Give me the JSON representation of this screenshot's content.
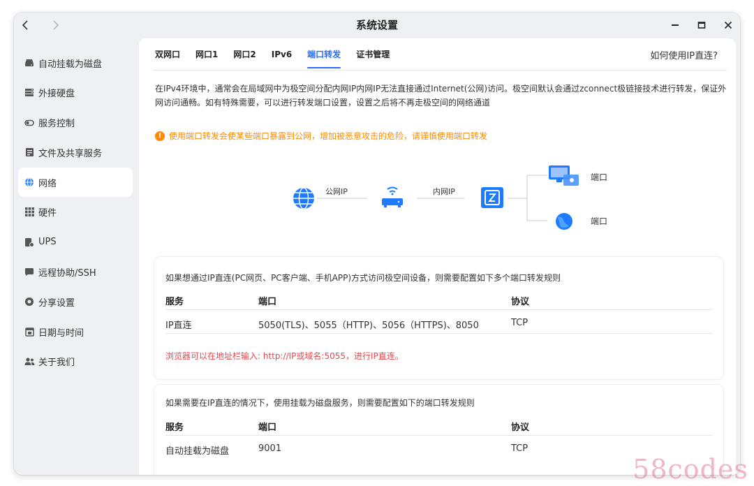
{
  "window": {
    "title": "系统设置",
    "nav": {
      "back_icon": "chevron-left-icon",
      "forward_icon": "chevron-right-icon"
    },
    "controls": [
      "minimize-icon",
      "maximize-icon",
      "close-icon"
    ]
  },
  "sidebar": {
    "active_index": 4,
    "items": [
      {
        "label": "自动挂载为磁盘",
        "icon": "drive-icon"
      },
      {
        "label": "外接硬盘",
        "icon": "external-disk-icon"
      },
      {
        "label": "服务控制",
        "icon": "toggle-icon"
      },
      {
        "label": "文件及共享服务",
        "icon": "file-share-icon"
      },
      {
        "label": "网络",
        "icon": "globe-icon"
      },
      {
        "label": "硬件",
        "icon": "grid-icon"
      },
      {
        "label": "UPS",
        "icon": "ups-icon"
      },
      {
        "label": "远程协助/SSH",
        "icon": "chat-icon"
      },
      {
        "label": "分享设置",
        "icon": "share-icon"
      },
      {
        "label": "日期与时间",
        "icon": "calendar-icon"
      },
      {
        "label": "关于我们",
        "icon": "users-icon"
      }
    ]
  },
  "tabs": {
    "active_index": 4,
    "items": [
      "双网口",
      "网口1",
      "网口2",
      "IPv6",
      "端口转发",
      "证书管理"
    ],
    "help_link": "如何使用IP直连?"
  },
  "content": {
    "description": "在IPv4环境中，通常会在局域网中为极空间分配内网IP内网IP无法直接通过Internet(公网)访问。极空间默认会通过zconnect极链接技术进行转发，保证外网访问通畅。如有特殊需要，可以进行转发端口设置，设置之后将不再走极空间的网络通道",
    "warning": "使用端口转发会使某些端口暴露到公网，增加被恶意攻击的危险，请谨慎使用端口转发",
    "diagram": {
      "public_ip_label": "公网IP",
      "lan_ip_label": "内网IP",
      "port_label_top": "端口",
      "port_label_bottom": "端口"
    }
  },
  "card1": {
    "title": "如果想通过IP直连(PC网页、PC客户端、手机APP)方式访问极空间设备，则需要配置如下多个端口转发规则",
    "headers": [
      "服务",
      "端口",
      "协议"
    ],
    "row": [
      "IP直连",
      "5050(TLS)、5055（HTTP)、5056（HTTPS)、8050",
      "TCP"
    ],
    "note": "浏览器可以在地址栏输入: http://IP或域名:5055，进行IP直连。"
  },
  "card2": {
    "title": "如果需要在IP直连的情况下，使用挂载为磁盘服务，则需要配置如下的端口转发规则",
    "headers": [
      "服务",
      "端口",
      "协议"
    ],
    "row": [
      "自动挂载为磁盘",
      "9001",
      "TCP"
    ]
  },
  "watermark": "58codes",
  "colors": {
    "accent": "#2a6cff",
    "warning": "#ff8a00",
    "note_red": "#e5484d"
  }
}
